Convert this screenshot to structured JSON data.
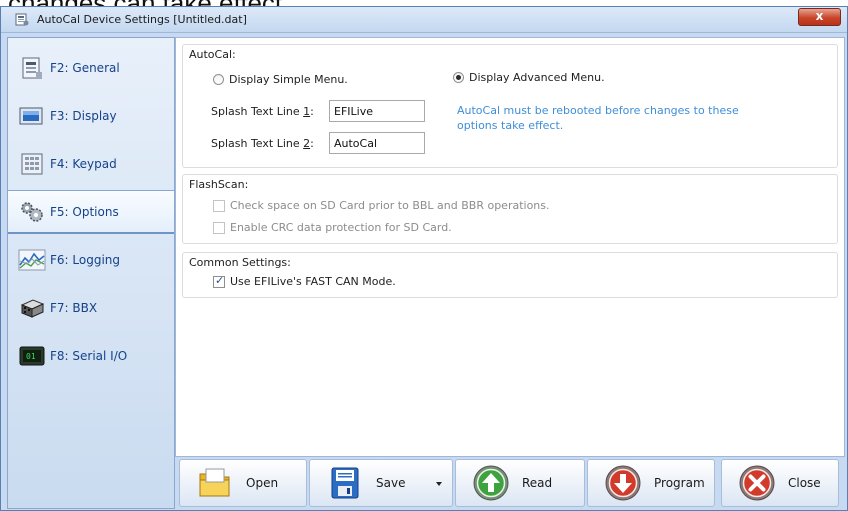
{
  "caption_fragment": "changes can take effect.",
  "window": {
    "title": "AutoCal Device Settings [Untitled.dat]",
    "close_glyph": "x"
  },
  "sidebar": {
    "items": [
      {
        "label": "F2: General",
        "icon": "general-icon",
        "active": false
      },
      {
        "label": "F3: Display",
        "icon": "display-icon",
        "active": false
      },
      {
        "label": "F4: Keypad",
        "icon": "keypad-icon",
        "active": false
      },
      {
        "label": "F5: Options",
        "icon": "options-icon",
        "active": true
      },
      {
        "label": "F6: Logging",
        "icon": "logging-icon",
        "active": false
      },
      {
        "label": "F7: BBX",
        "icon": "bbx-icon",
        "active": false
      },
      {
        "label": "F8: Serial I/O",
        "icon": "serial-icon",
        "active": false
      }
    ]
  },
  "autocal": {
    "group_title": "AutoCal:",
    "simple_menu_label": "Display Simple Menu.",
    "advanced_menu_label": "Display Advanced Menu.",
    "selected_menu": "advanced",
    "splash1_label_prefix": "Splash Text Line ",
    "splash1_label_key": "1",
    "splash1_label_suffix": ":",
    "splash1_value": "EFILive",
    "splash2_label_prefix": "Splash Text Line ",
    "splash2_label_key": "2",
    "splash2_label_suffix": ":",
    "splash2_value": "AutoCal",
    "info_line1": "AutoCal must be rebooted before changes to these",
    "info_line2": "options take effect."
  },
  "flashscan": {
    "group_title": "FlashScan:",
    "check_sd_label": "Check space on SD Card prior to BBL and BBR operations.",
    "check_sd_checked": false,
    "crc_label": "Enable CRC data protection for SD Card.",
    "crc_checked": false
  },
  "common": {
    "group_title": "Common Settings:",
    "fast_can_label": "Use EFILive's FAST CAN Mode.",
    "fast_can_checked": true
  },
  "buttons": {
    "open": "Open",
    "save": "Save",
    "read": "Read",
    "program": "Program",
    "close": "Close"
  },
  "colors": {
    "info_text": "#3e8ed8",
    "nav_text": "#15428b",
    "frame_bg": "#c7daf1"
  }
}
